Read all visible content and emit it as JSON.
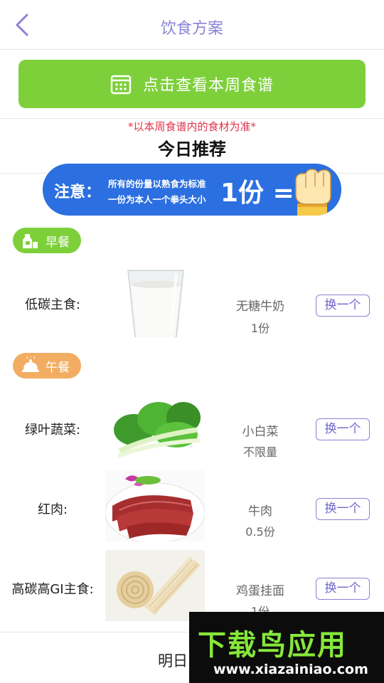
{
  "header": {
    "title": "饮食方案"
  },
  "week_button": {
    "label": "点击查看本周食谱"
  },
  "notice": "*以本周食谱内的食材为准*",
  "section_title": "今日推荐",
  "banner": {
    "attention": "注意：",
    "line1": "所有的份量以熟食为标准",
    "line2": "一份为本人一个拳头大小",
    "portion": "1份 ="
  },
  "meals": {
    "breakfast": {
      "label": "早餐"
    },
    "lunch": {
      "label": "午餐"
    }
  },
  "items": [
    {
      "category": "低碳主食:",
      "food": "无糖牛奶",
      "qty": "1份",
      "swap": "换一个",
      "image": "milk-glass"
    },
    {
      "category": "绿叶蔬菜:",
      "food": "小白菜",
      "qty": "不限量",
      "swap": "换一个",
      "image": "bok-choy"
    },
    {
      "category": "红肉:",
      "food": "牛肉",
      "qty": "0.5份",
      "swap": "换一个",
      "image": "sliced-beef"
    },
    {
      "category": "高碳高GI主食:",
      "food": "鸡蛋挂面",
      "qty": "1份",
      "swap": "换一个",
      "image": "egg-noodles"
    }
  ],
  "bottom": {
    "label": "明日"
  },
  "watermark": {
    "title": "下载鸟应用",
    "url": "www.xiazainiao.com"
  },
  "colors": {
    "accent": "#8a83d6",
    "green": "#7ed03b",
    "orange": "#f2ad62",
    "banner": "#2b6fe0",
    "notice": "#e0334b"
  }
}
